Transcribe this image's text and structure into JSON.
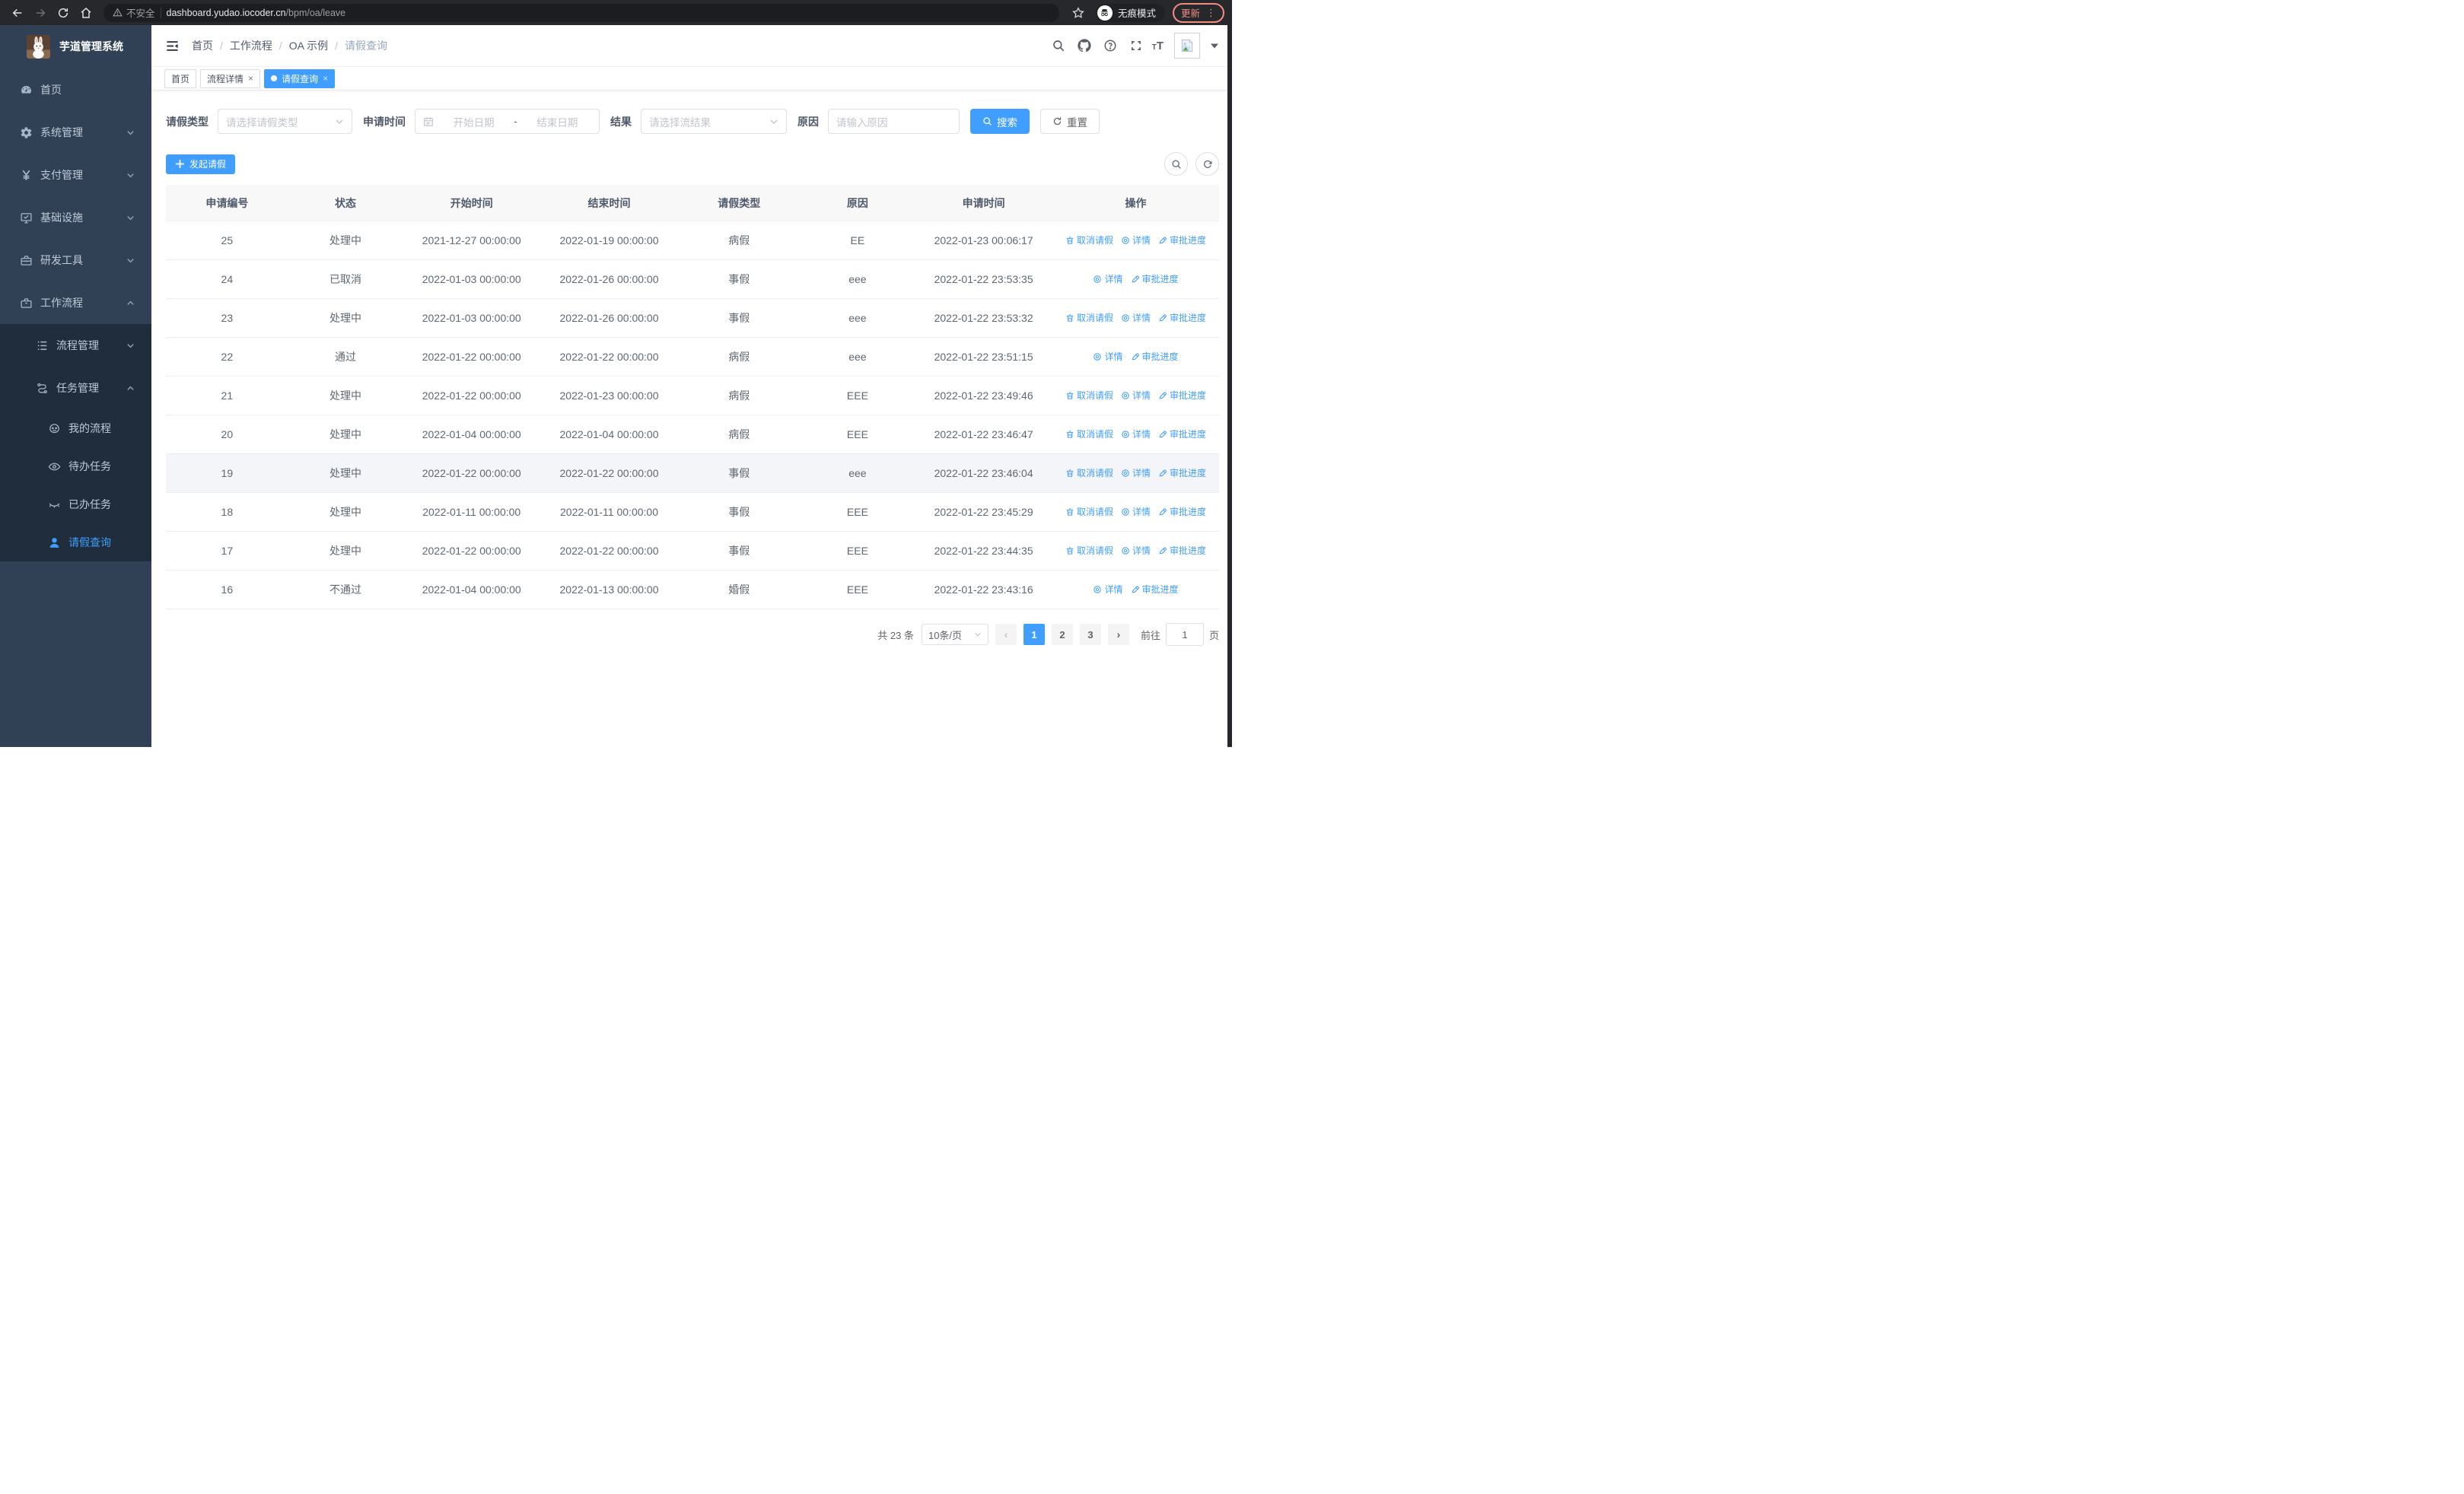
{
  "colors": {
    "accent": "#409eff",
    "sidebar_bg": "#304156",
    "submenu_bg": "#1f2d3d",
    "update": "#f28b82",
    "link": "#409eff"
  },
  "browser": {
    "insecure_label": "不安全",
    "url_host": "dashboard.yudao.iocoder.cn",
    "url_path": "/bpm/oa/leave",
    "incognito_label": "无痕模式",
    "update_label": "更新",
    "menu_dots": "⋮",
    "back": "←",
    "forward": "→"
  },
  "sidebar": {
    "title": "芋道管理系统",
    "menu": [
      {
        "label": "首页",
        "icon": "dashboard",
        "level": 1,
        "chevron": null,
        "active": false,
        "dark": false
      },
      {
        "label": "系统管理",
        "icon": "gear",
        "level": 1,
        "chevron": "down",
        "active": false,
        "dark": false
      },
      {
        "label": "支付管理",
        "icon": "yen",
        "level": 1,
        "chevron": "down",
        "active": false,
        "dark": false
      },
      {
        "label": "基础设施",
        "icon": "monitor",
        "level": 1,
        "chevron": "down",
        "active": false,
        "dark": false
      },
      {
        "label": "研发工具",
        "icon": "toolbox",
        "level": 1,
        "chevron": "down",
        "active": false,
        "dark": false
      },
      {
        "label": "工作流程",
        "icon": "briefcase",
        "level": 1,
        "chevron": "up",
        "active": false,
        "dark": false
      },
      {
        "label": "流程管理",
        "icon": "list-tree",
        "level": 2,
        "chevron": "down",
        "active": false,
        "dark": true
      },
      {
        "label": "任务管理",
        "icon": "route",
        "level": 2,
        "chevron": "up",
        "active": false,
        "dark": true
      },
      {
        "label": "我的流程",
        "icon": "robot-face",
        "level": 3,
        "chevron": null,
        "active": false,
        "dark": true
      },
      {
        "label": "待办任务",
        "icon": "eye",
        "level": 3,
        "chevron": null,
        "active": false,
        "dark": true
      },
      {
        "label": "已办任务",
        "icon": "eye-closed",
        "level": 3,
        "chevron": null,
        "active": false,
        "dark": true
      },
      {
        "label": "请假查询",
        "icon": "user",
        "level": 3,
        "chevron": null,
        "active": true,
        "dark": true
      }
    ]
  },
  "breadcrumb": {
    "items": [
      "首页",
      "工作流程",
      "OA 示例",
      "请假查询"
    ]
  },
  "tags": {
    "items": [
      {
        "label": "首页",
        "closable": false,
        "active": false
      },
      {
        "label": "流程详情",
        "closable": true,
        "active": false
      },
      {
        "label": "请假查询",
        "closable": true,
        "active": true
      }
    ],
    "close_glyph": "×"
  },
  "filters": {
    "type_label": "请假类型",
    "type_placeholder": "请选择请假类型",
    "time_label": "申请时间",
    "start_placeholder": "开始日期",
    "range_separator": "-",
    "end_placeholder": "结束日期",
    "result_label": "结果",
    "result_placeholder": "请选择流结果",
    "reason_label": "原因",
    "reason_placeholder": "请输入原因",
    "search_label": "搜索",
    "reset_label": "重置"
  },
  "toolbar": {
    "create_label": "发起请假"
  },
  "table": {
    "columns": [
      "申请编号",
      "状态",
      "开始时间",
      "结束时间",
      "请假类型",
      "原因",
      "申请时间",
      "操作"
    ],
    "action_labels": {
      "cancel": "取消请假",
      "detail": "详情",
      "progress": "审批进度"
    },
    "rows": [
      {
        "id": "25",
        "status": "处理中",
        "start": "2021-12-27 00:00:00",
        "end": "2022-01-19 00:00:00",
        "type": "病假",
        "reason": "EE",
        "applied": "2022-01-23 00:06:17",
        "actions": [
          "cancel",
          "detail",
          "progress"
        ],
        "highlighted": false
      },
      {
        "id": "24",
        "status": "已取消",
        "start": "2022-01-03 00:00:00",
        "end": "2022-01-26 00:00:00",
        "type": "事假",
        "reason": "eee",
        "applied": "2022-01-22 23:53:35",
        "actions": [
          "detail",
          "progress"
        ],
        "highlighted": false
      },
      {
        "id": "23",
        "status": "处理中",
        "start": "2022-01-03 00:00:00",
        "end": "2022-01-26 00:00:00",
        "type": "事假",
        "reason": "eee",
        "applied": "2022-01-22 23:53:32",
        "actions": [
          "cancel",
          "detail",
          "progress"
        ],
        "highlighted": false
      },
      {
        "id": "22",
        "status": "通过",
        "start": "2022-01-22 00:00:00",
        "end": "2022-01-22 00:00:00",
        "type": "病假",
        "reason": "eee",
        "applied": "2022-01-22 23:51:15",
        "actions": [
          "detail",
          "progress"
        ],
        "highlighted": false
      },
      {
        "id": "21",
        "status": "处理中",
        "start": "2022-01-22 00:00:00",
        "end": "2022-01-23 00:00:00",
        "type": "病假",
        "reason": "EEE",
        "applied": "2022-01-22 23:49:46",
        "actions": [
          "cancel",
          "detail",
          "progress"
        ],
        "highlighted": false
      },
      {
        "id": "20",
        "status": "处理中",
        "start": "2022-01-04 00:00:00",
        "end": "2022-01-04 00:00:00",
        "type": "病假",
        "reason": "EEE",
        "applied": "2022-01-22 23:46:47",
        "actions": [
          "cancel",
          "detail",
          "progress"
        ],
        "highlighted": false
      },
      {
        "id": "19",
        "status": "处理中",
        "start": "2022-01-22 00:00:00",
        "end": "2022-01-22 00:00:00",
        "type": "事假",
        "reason": "eee",
        "applied": "2022-01-22 23:46:04",
        "actions": [
          "cancel",
          "detail",
          "progress"
        ],
        "highlighted": true
      },
      {
        "id": "18",
        "status": "处理中",
        "start": "2022-01-11 00:00:00",
        "end": "2022-01-11 00:00:00",
        "type": "事假",
        "reason": "EEE",
        "applied": "2022-01-22 23:45:29",
        "actions": [
          "cancel",
          "detail",
          "progress"
        ],
        "highlighted": false
      },
      {
        "id": "17",
        "status": "处理中",
        "start": "2022-01-22 00:00:00",
        "end": "2022-01-22 00:00:00",
        "type": "事假",
        "reason": "EEE",
        "applied": "2022-01-22 23:44:35",
        "actions": [
          "cancel",
          "detail",
          "progress"
        ],
        "highlighted": false
      },
      {
        "id": "16",
        "status": "不通过",
        "start": "2022-01-04 00:00:00",
        "end": "2022-01-13 00:00:00",
        "type": "婚假",
        "reason": "EEE",
        "applied": "2022-01-22 23:43:16",
        "actions": [
          "detail",
          "progress"
        ],
        "highlighted": false
      }
    ]
  },
  "pagination": {
    "total_label": "共 23 条",
    "page_size_label": "10条/页",
    "pages": [
      "1",
      "2",
      "3"
    ],
    "active_page": "1",
    "prev_glyph": "‹",
    "next_glyph": "›",
    "goto_label": "前往",
    "goto_value": "1",
    "goto_suffix": "页"
  }
}
